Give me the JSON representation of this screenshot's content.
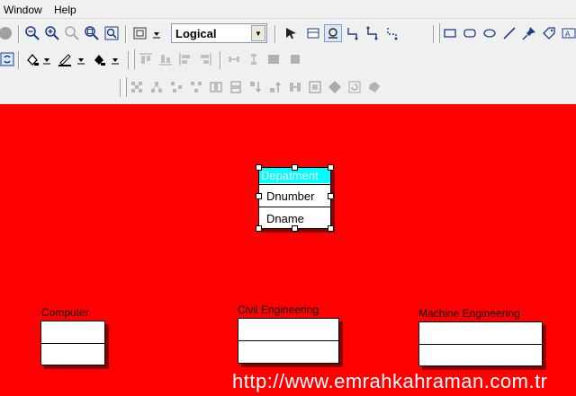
{
  "menu": {
    "items": [
      "Window",
      "Help"
    ]
  },
  "toolbar": {
    "view_mode_combo": {
      "selected": "Logical"
    }
  },
  "diagram": {
    "selected_entity": {
      "title": "Depatment",
      "attributes": [
        "Dnumber",
        "Dname"
      ]
    },
    "entities": [
      {
        "label": "Computer"
      },
      {
        "label": "Civil Engineering"
      },
      {
        "label": "Machine Engineering"
      }
    ]
  },
  "watermark": "http://www.emrahkahraman.com.tr",
  "colors": {
    "canvas": "#ff0000",
    "selected_title": "#00ffff",
    "shadow": "#8a0000"
  }
}
